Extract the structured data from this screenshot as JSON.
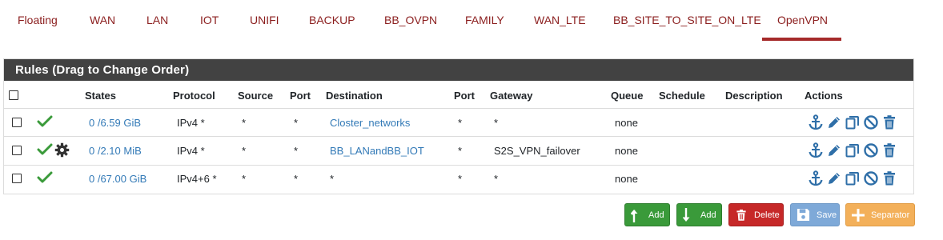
{
  "tabs": [
    {
      "label": "Floating"
    },
    {
      "label": "WAN"
    },
    {
      "label": "LAN"
    },
    {
      "label": "IOT"
    },
    {
      "label": "UNIFI"
    },
    {
      "label": "BACKUP"
    },
    {
      "label": "BB_OVPN"
    },
    {
      "label": "FAMILY"
    },
    {
      "label": "WAN_LTE"
    },
    {
      "label": "BB_SITE_TO_SITE_ON_LTE"
    },
    {
      "label": "OpenVPN",
      "active": true
    }
  ],
  "panel": {
    "title": "Rules (Drag to Change Order)"
  },
  "table": {
    "headers": {
      "states": "States",
      "protocol": "Protocol",
      "source": "Source",
      "port": "Port",
      "destination": "Destination",
      "dport": "Port",
      "gateway": "Gateway",
      "queue": "Queue",
      "schedule": "Schedule",
      "description": "Description",
      "actions": "Actions"
    },
    "rows": [
      {
        "states": "0 /6.59 GiB",
        "protocol": "IPv4 *",
        "source": "*",
        "port": "*",
        "destination": "Closter_networks",
        "destination_link": true,
        "dport": "*",
        "gateway": "*",
        "queue": "none",
        "schedule": "",
        "description": "",
        "has_gear": false
      },
      {
        "states": "0 /2.10 MiB",
        "protocol": "IPv4 *",
        "source": "*",
        "port": "*",
        "destination": "BB_LANandBB_IOT",
        "destination_link": true,
        "dport": "*",
        "gateway": "S2S_VPN_failover",
        "queue": "none",
        "schedule": "",
        "description": "",
        "has_gear": true
      },
      {
        "states": "0 /67.00 GiB",
        "protocol": "IPv4+6 *",
        "source": "*",
        "port": "*",
        "destination": "*",
        "destination_link": false,
        "dport": "*",
        "gateway": "*",
        "queue": "none",
        "schedule": "",
        "description": "",
        "has_gear": false
      }
    ]
  },
  "buttons": {
    "add_top": "Add",
    "add_bottom": "Add",
    "delete": "Delete",
    "save": "Save",
    "separator": "Separator"
  },
  "colors": {
    "tab_text": "#8b1e1e",
    "tab_active_underline": "#a52a2a",
    "panel_heading_bg": "#424242",
    "link": "#337ab7",
    "check_green": "#3a9a3a",
    "action_blue": "#2f6fa8"
  },
  "icons": [
    "check-icon",
    "gear-icon",
    "anchor-icon",
    "pencil-icon",
    "copy-icon",
    "disable-icon",
    "trash-icon",
    "arrow-up-icon",
    "arrow-down-icon",
    "save-icon",
    "plus-icon"
  ]
}
